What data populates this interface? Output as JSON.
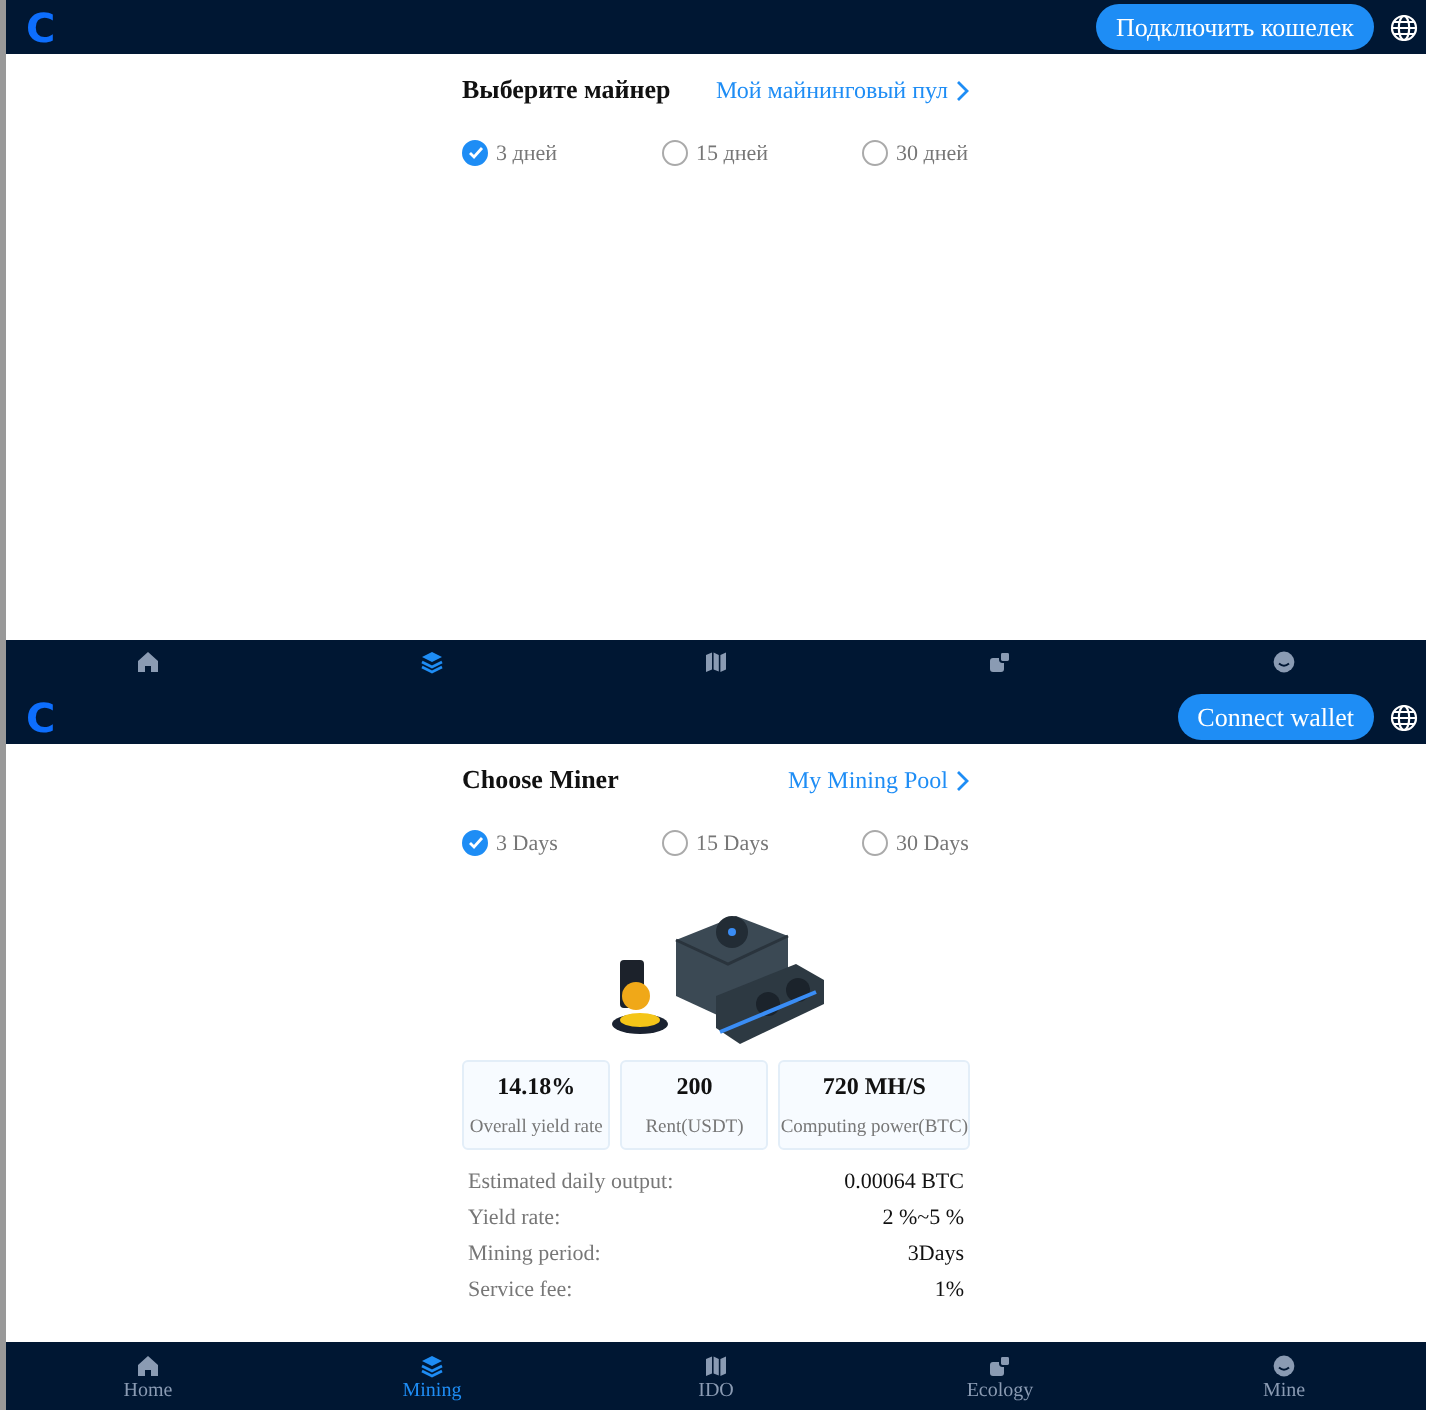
{
  "screens": [
    {
      "header": {
        "logo": "C",
        "connect_button": "Подключить кошелек"
      },
      "title": "Выберите майнер",
      "pool_link": "Мой майнинговый пул",
      "periods": [
        {
          "label": "3 дней",
          "selected": true
        },
        {
          "label": "15 дней",
          "selected": false
        },
        {
          "label": "30 дней",
          "selected": false
        }
      ],
      "nav": [
        {
          "selected": false
        },
        {
          "selected": true
        },
        {
          "selected": false
        },
        {
          "selected": false
        },
        {
          "selected": false
        }
      ]
    },
    {
      "header": {
        "logo": "C",
        "connect_button": "Connect wallet"
      },
      "title": "Choose Miner",
      "pool_link": "My Mining Pool",
      "periods": [
        {
          "label": "3 Days",
          "selected": true
        },
        {
          "label": "15 Days",
          "selected": false
        },
        {
          "label": "30 Days",
          "selected": false
        }
      ],
      "stats": [
        {
          "value": "14.18%",
          "label": "Overall yield rate"
        },
        {
          "value": "200",
          "label": "Rent(USDT)"
        },
        {
          "value": "720 MH/S",
          "label": "Computing power(BTC)"
        }
      ],
      "details": [
        {
          "label": "Estimated daily output:",
          "value": "0.00064 BTC"
        },
        {
          "label": "Yield rate:",
          "value": "2 %~5 %"
        },
        {
          "label": "Mining period:",
          "value": "3Days"
        },
        {
          "label": "Service fee:",
          "value": "1%"
        }
      ],
      "nav": [
        {
          "label": "Home",
          "selected": false
        },
        {
          "label": "Mining",
          "selected": true
        },
        {
          "label": "IDO",
          "selected": false
        },
        {
          "label": "Ecology",
          "selected": false
        },
        {
          "label": "Mine",
          "selected": false
        }
      ]
    }
  ]
}
